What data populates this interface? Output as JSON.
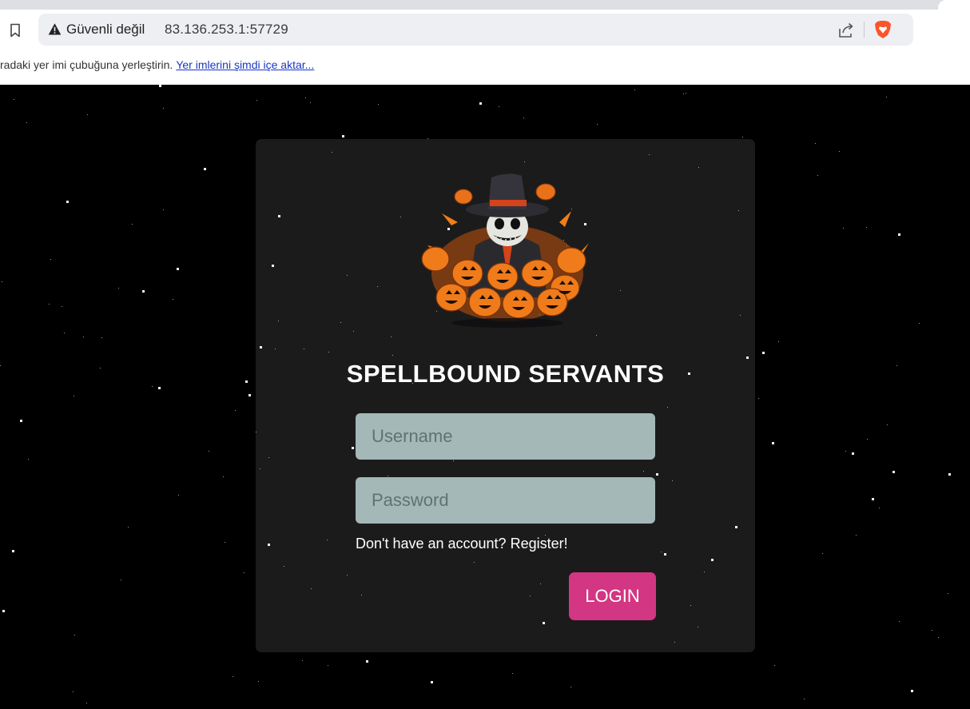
{
  "browser": {
    "security_label": "Güvenli değil",
    "url": "83.136.253.1:57729",
    "bookmarks_hint": "radaki yer imi çubuğuna yerleştirin.",
    "import_link": "Yer imlerini şimdi içe aktar..."
  },
  "login": {
    "title": "SPELLBOUND SERVANTS",
    "username_placeholder": "Username",
    "password_placeholder": "Password",
    "register_text": "Don't have an account? Register!",
    "login_label": "LOGIN"
  },
  "colors": {
    "background": "#000000",
    "card": "#1c1b1b",
    "input": "#a3b8b7",
    "login_button": "#d33682",
    "brave_orange": "#fb542b"
  },
  "icons": {
    "bookmark": "bookmark-icon",
    "warning": "warning-icon",
    "share": "share-icon",
    "brave": "brave-lion-icon",
    "mascot": "pumpkin-scarecrow-logo"
  }
}
